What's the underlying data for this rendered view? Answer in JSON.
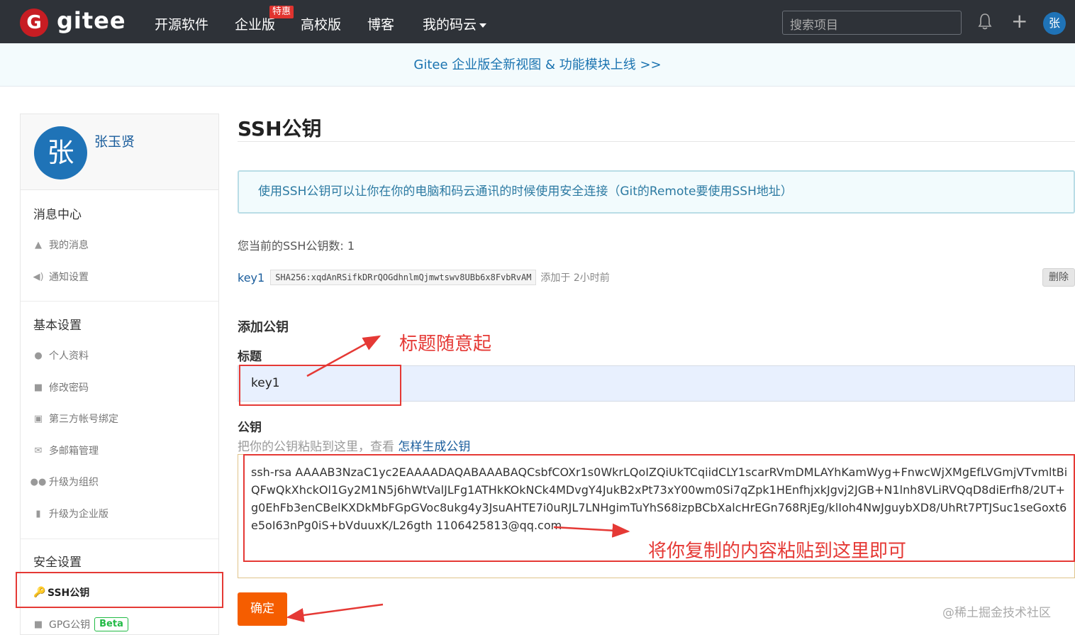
{
  "nav": {
    "logo_letter": "G",
    "brand": "gitee",
    "links": [
      "开源软件",
      "企业版",
      "高校版",
      "博客",
      "我的码云"
    ],
    "hot_badge": "特惠",
    "search_placeholder": "搜索项目",
    "avatar_letter": "张"
  },
  "banner": {
    "text": "Gitee 企业版全新视图 & 功能模块上线 >>"
  },
  "sidebar": {
    "avatar_letter": "张",
    "username": "张玉贤",
    "sections": {
      "messages": {
        "title": "消息中心",
        "items": [
          "我的消息",
          "通知设置"
        ]
      },
      "basic": {
        "title": "基本设置",
        "items": [
          "个人资料",
          "修改密码",
          "第三方帐号绑定",
          "多邮箱管理",
          "升级为组织",
          "升级为企业版"
        ]
      },
      "security": {
        "title": "安全设置",
        "items": [
          "SSH公钥",
          "GPG公钥"
        ],
        "beta": "Beta"
      }
    }
  },
  "main": {
    "title": "SSH公钥",
    "info": "使用SSH公钥可以让你在你的电脑和码云通讯的时候使用安全连接（Git的Remote要使用SSH地址）",
    "count_text": "您当前的SSH公钥数: 1",
    "key": {
      "name": "key1",
      "fingerprint": "SHA256:xqdAnRSifkDRrQOGdhnlmQjmwtswv8UBb6x8FvbRvAM",
      "added": "添加于 2小时前",
      "delete_label": "删除"
    },
    "add_section": "添加公钥",
    "title_label": "标题",
    "title_value": "key1",
    "key_label": "公钥",
    "hint_prefix": "把你的公钥粘贴到这里，查看 ",
    "hint_link": "怎样生成公钥",
    "key_value": "ssh-rsa AAAAB3NzaC1yc2EAAAADAQABAAABAQCsbfCOXr1s0WkrLQoIZQiUkTCqiidCLY1scarRVmDMLAYhKamWyg+FnwcWjXMgEfLVGmjVTvmltBiQFwQkXhckOl1Gy2M1N5j6hWtValJLFg1ATHkKOkNCk4MDvgY4JukB2xPt73xY00wm0Si7qZpk1HEnfhjxkJgvj2JGB+N1lnh8VLiRVQqD8diErfh8/2UT+g0EhFb3enCBelKXDkMbFGpGVoc8ukg4y3JsuAHTE7i0uRJL7LNHgimTuYhS68izpBCbXalcHrEGn768RjEg/klIoh4NwJguybXD8/UhRt7PTJSuc1seGoxt6e5oI63nPg0iS+bVduuxK/L26gth 1106425813@qq.com",
    "confirm_label": "确定"
  },
  "annotations": {
    "title_note": "标题随意起",
    "key_note": "将你复制的内容粘贴到这里即可"
  },
  "watermark": "@稀土掘金技术社区"
}
